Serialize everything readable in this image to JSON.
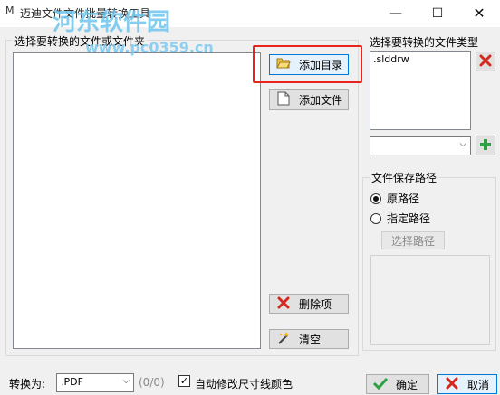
{
  "window": {
    "title": "迈迪文件文件批量转换工具",
    "app_icon": "M",
    "minimize_icon": "—",
    "maximize_icon": "☐",
    "close_icon": "✕"
  },
  "watermark": {
    "title": "河东软件园",
    "url": "www.pc0359.cn"
  },
  "left_panel": {
    "group_label": "选择要转换的文件或文件夹",
    "add_dir_label": "添加目录",
    "add_file_label": "添加文件",
    "delete_label": "删除项",
    "clear_label": "清空"
  },
  "file_types": {
    "label": "选择要转换的文件类型",
    "items": [
      ".slddrw"
    ],
    "combo_value": ""
  },
  "save_path": {
    "group_label": "文件保存路径",
    "option_original": "原路径",
    "option_specified": "指定路径",
    "selected": "原路径",
    "choose_button": "选择路径"
  },
  "bottom": {
    "convert_label": "转换为:",
    "convert_value": ".PDF",
    "count": "(0/0)",
    "auto_modify_label": "自动修改尺寸线颜色",
    "auto_modify_checked": true,
    "ok_label": "确定",
    "cancel_label": "取消"
  },
  "colors": {
    "highlight_box": "#e8241c",
    "focus_border": "#0078d7",
    "watermark": "#6ec6ee"
  }
}
